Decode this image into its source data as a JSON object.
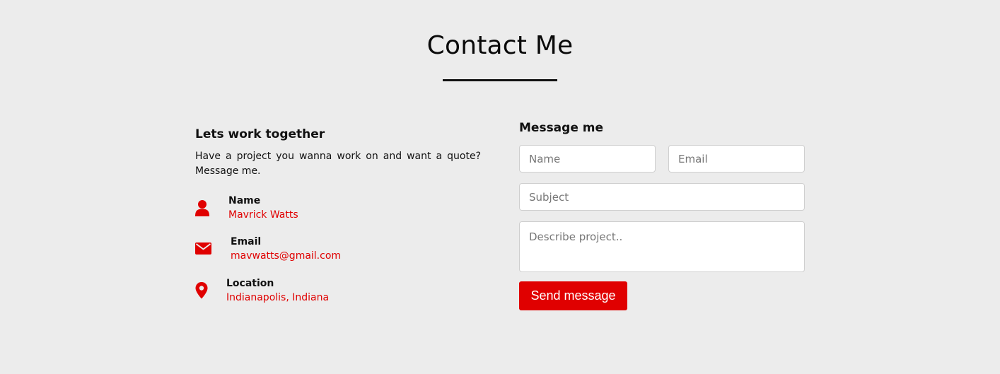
{
  "page": {
    "title": "Contact Me"
  },
  "about": {
    "heading": "Lets work together",
    "intro": "Have a project you wanna work on and want a quote? Message me.",
    "items": [
      {
        "icon": "user-icon",
        "label": "Name",
        "value": "Mavrick Watts"
      },
      {
        "icon": "envelope-icon",
        "label": "Email",
        "value": "mavwatts@gmail.com"
      },
      {
        "icon": "map-pin-icon",
        "label": "Location",
        "value": "Indianapolis, Indiana"
      }
    ]
  },
  "form": {
    "heading": "Message me",
    "name_placeholder": "Name",
    "email_placeholder": "Email",
    "subject_placeholder": "Subject",
    "message_placeholder": "Describe project..",
    "submit_label": "Send message"
  },
  "colors": {
    "accent": "#e00000",
    "background": "#ececec"
  }
}
